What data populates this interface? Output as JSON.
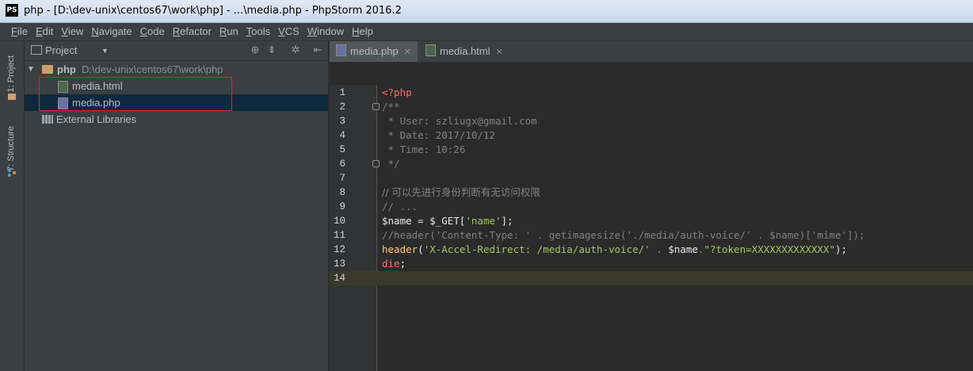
{
  "window": {
    "app_icon": "PS",
    "title": "php - [D:\\dev-unix\\centos67\\work\\php] - ...\\media.php - PhpStorm 2016.2"
  },
  "menu": [
    "File",
    "Edit",
    "View",
    "Navigate",
    "Code",
    "Refactor",
    "Run",
    "Tools",
    "VCS",
    "Window",
    "Help"
  ],
  "side_tabs": {
    "project": "1: Project",
    "structure": "7: Structure"
  },
  "project_panel": {
    "selector": "Project",
    "root": {
      "name": "php",
      "path": "D:\\dev-unix\\centos67\\work\\php"
    },
    "files": [
      "media.html",
      "media.php"
    ],
    "libraries": "External Libraries"
  },
  "editor_tabs": [
    {
      "label": "media.php",
      "icon": "php-file-icon",
      "active": true
    },
    {
      "label": "media.html",
      "icon": "html-file-icon",
      "active": false
    }
  ],
  "code_lines": {
    "l1": "<?php",
    "l2": "/**",
    "l3": " * User: szliugx@gmail.com",
    "l4": " * Date: 2017/10/12",
    "l5": " * Time: 10:26",
    "l6": " */",
    "l7": "",
    "l8": "// 可以先进行身份判断有无访问权限",
    "l9": "// ...",
    "l10_var": "$name",
    "l10_rest": " = $_GET[",
    "l10_str": "'name'",
    "l10_end": "];",
    "l11": "//header('Content-Type: ' . getimagesize('./media/auth-voice/' . $name)['mime']);",
    "l12_fn": "header",
    "l12_p1": "(",
    "l12_s1": "'X-Accel-Redirect: /media/auth-voice/'",
    "l12_dot": " . ",
    "l12_var": "$name",
    "l12_dot2": ".",
    "l12_s2": "\"?token=XXXXXXXXXXXXX\"",
    "l12_end": ");",
    "l13_die": "die",
    "l13_end": ";",
    "l14": ""
  },
  "line_numbers": [
    "1",
    "2",
    "3",
    "4",
    "5",
    "6",
    "7",
    "8",
    "9",
    "10",
    "11",
    "12",
    "13",
    "14"
  ]
}
